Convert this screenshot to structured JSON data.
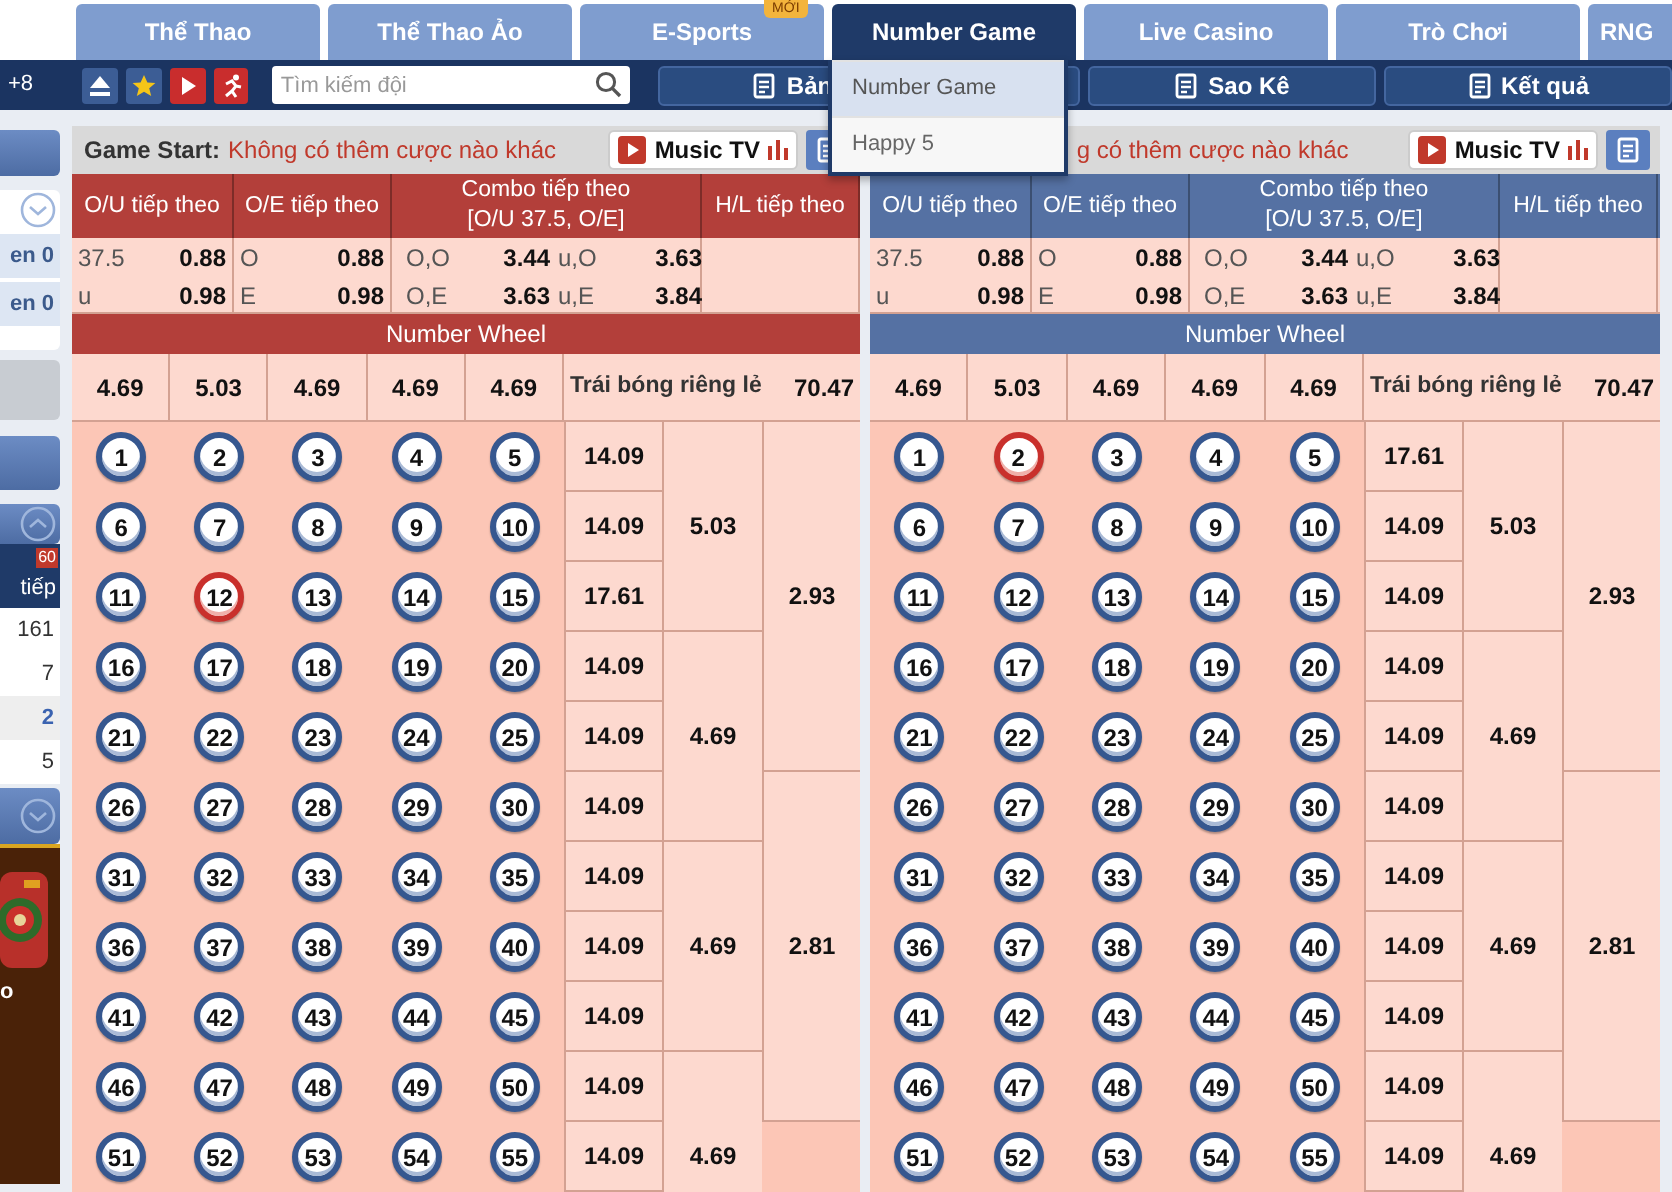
{
  "top_bar": {
    "text": "+8"
  },
  "tabs": [
    {
      "label": "Thể Thao",
      "selected": false
    },
    {
      "label": "Thể Thao Ảo",
      "selected": false
    },
    {
      "label": "E-Sports",
      "selected": false,
      "badge": "MỚI"
    },
    {
      "label": "Number Game",
      "selected": true
    },
    {
      "label": "Live Casino",
      "selected": false
    },
    {
      "label": "Trò Chơi",
      "selected": false
    },
    {
      "label": "RNG",
      "selected": false
    }
  ],
  "search": {
    "placeholder": "Tìm kiếm đội"
  },
  "toolbar_buttons": [
    "Bản",
    "Sao Kê",
    "Kết quả"
  ],
  "dropdown": [
    {
      "label": "Number Game",
      "selected": true
    },
    {
      "label": "Happy 5",
      "selected": false
    }
  ],
  "sidebar": {
    "rows": [
      "en 0",
      "en 0"
    ],
    "header": "tiếp",
    "badge": "60",
    "counts": [
      {
        "text": "161",
        "highlighted": false
      },
      {
        "text": "7",
        "highlighted": false
      },
      {
        "text": "2",
        "highlighted": true
      },
      {
        "text": "5",
        "highlighted": false
      }
    ],
    "game_label": "o"
  },
  "panels": [
    {
      "color": "#b33f3a",
      "header": {
        "label": "Game Start:",
        "status": "Không có thêm cược nào khác"
      },
      "music_button": "Music TV",
      "columns": [
        [
          "O/U tiếp theo"
        ],
        [
          "O/E tiếp theo"
        ],
        [
          "Combo tiếp theo",
          "[O/U 37.5, O/E]"
        ],
        [
          "H/L tiếp theo"
        ]
      ],
      "ou": [
        [
          "37.5",
          "0.88"
        ],
        [
          "u",
          "0.98"
        ]
      ],
      "oe": [
        [
          "O",
          "0.88"
        ],
        [
          "E",
          "0.98"
        ]
      ],
      "combo": [
        [
          "O,O",
          "3.44",
          "u,O",
          "3.63"
        ],
        [
          "O,E",
          "3.63",
          "u,E",
          "3.84"
        ]
      ],
      "wheel_title": "Number Wheel",
      "wheel_odds": [
        "4.69",
        "5.03",
        "4.69",
        "4.69",
        "4.69"
      ],
      "single_ball": {
        "label": "Trái bóng riêng lẻ",
        "odds": "70.47"
      },
      "balls": [
        {
          "number": "1",
          "selected": false
        },
        {
          "number": "2",
          "selected": false
        },
        {
          "number": "3",
          "selected": false
        },
        {
          "number": "4",
          "selected": false
        },
        {
          "number": "5",
          "selected": false
        },
        {
          "number": "6",
          "selected": false
        },
        {
          "number": "7",
          "selected": false
        },
        {
          "number": "8",
          "selected": false
        },
        {
          "number": "9",
          "selected": false
        },
        {
          "number": "10",
          "selected": false
        },
        {
          "number": "11",
          "selected": false
        },
        {
          "number": "12",
          "selected": true
        },
        {
          "number": "13",
          "selected": false
        },
        {
          "number": "14",
          "selected": false
        },
        {
          "number": "15",
          "selected": false
        },
        {
          "number": "16",
          "selected": false
        },
        {
          "number": "17",
          "selected": false
        },
        {
          "number": "18",
          "selected": false
        },
        {
          "number": "19",
          "selected": false
        },
        {
          "number": "20",
          "selected": false
        },
        {
          "number": "21",
          "selected": false
        },
        {
          "number": "22",
          "selected": false
        },
        {
          "number": "23",
          "selected": false
        },
        {
          "number": "24",
          "selected": false
        },
        {
          "number": "25",
          "selected": false
        },
        {
          "number": "26",
          "selected": false
        },
        {
          "number": "27",
          "selected": false
        },
        {
          "number": "28",
          "selected": false
        },
        {
          "number": "29",
          "selected": false
        },
        {
          "number": "30",
          "selected": false
        },
        {
          "number": "31",
          "selected": false
        },
        {
          "number": "32",
          "selected": false
        },
        {
          "number": "33",
          "selected": false
        },
        {
          "number": "34",
          "selected": false
        },
        {
          "number": "35",
          "selected": false
        },
        {
          "number": "36",
          "selected": false
        },
        {
          "number": "37",
          "selected": false
        },
        {
          "number": "38",
          "selected": false
        },
        {
          "number": "39",
          "selected": false
        },
        {
          "number": "40",
          "selected": false
        },
        {
          "number": "41",
          "selected": false
        },
        {
          "number": "42",
          "selected": false
        },
        {
          "number": "43",
          "selected": false
        },
        {
          "number": "44",
          "selected": false
        },
        {
          "number": "45",
          "selected": false
        },
        {
          "number": "46",
          "selected": false
        },
        {
          "number": "47",
          "selected": false
        },
        {
          "number": "48",
          "selected": false
        },
        {
          "number": "49",
          "selected": false
        },
        {
          "number": "50",
          "selected": false
        },
        {
          "number": "51",
          "selected": false
        },
        {
          "number": "52",
          "selected": false
        },
        {
          "number": "53",
          "selected": false
        },
        {
          "number": "54",
          "selected": false
        },
        {
          "number": "55",
          "selected": false
        }
      ],
      "row_odds": [
        "14.09",
        "14.09",
        "17.61",
        "14.09",
        "14.09",
        "14.09",
        "14.09",
        "14.09",
        "14.09",
        "14.09",
        "14.09"
      ],
      "group3_odds": [
        "5.03",
        "4.69",
        "4.69",
        "4.69"
      ],
      "group5_odds": [
        "2.93",
        "2.81"
      ]
    },
    {
      "color": "#5571a3",
      "header": {
        "status": "g có thêm cược nào khác"
      },
      "music_button": "Music TV",
      "columns": [
        [
          "O/U tiếp theo"
        ],
        [
          "O/E tiếp theo"
        ],
        [
          "Combo tiếp theo",
          "[O/U 37.5, O/E]"
        ],
        [
          "H/L tiếp theo"
        ]
      ],
      "ou": [
        [
          "37.5",
          "0.88"
        ],
        [
          "u",
          "0.98"
        ]
      ],
      "oe": [
        [
          "O",
          "0.88"
        ],
        [
          "E",
          "0.98"
        ]
      ],
      "combo": [
        [
          "O,O",
          "3.44",
          "u,O",
          "3.63"
        ],
        [
          "O,E",
          "3.63",
          "u,E",
          "3.84"
        ]
      ],
      "wheel_title": "Number Wheel",
      "wheel_odds": [
        "4.69",
        "5.03",
        "4.69",
        "4.69",
        "4.69"
      ],
      "single_ball": {
        "label": "Trái bóng riêng lẻ",
        "odds": "70.47"
      },
      "balls": [
        {
          "number": "1",
          "selected": false
        },
        {
          "number": "2",
          "selected": true
        },
        {
          "number": "3",
          "selected": false
        },
        {
          "number": "4",
          "selected": false
        },
        {
          "number": "5",
          "selected": false
        },
        {
          "number": "6",
          "selected": false
        },
        {
          "number": "7",
          "selected": false
        },
        {
          "number": "8",
          "selected": false
        },
        {
          "number": "9",
          "selected": false
        },
        {
          "number": "10",
          "selected": false
        },
        {
          "number": "11",
          "selected": false
        },
        {
          "number": "12",
          "selected": false
        },
        {
          "number": "13",
          "selected": false
        },
        {
          "number": "14",
          "selected": false
        },
        {
          "number": "15",
          "selected": false
        },
        {
          "number": "16",
          "selected": false
        },
        {
          "number": "17",
          "selected": false
        },
        {
          "number": "18",
          "selected": false
        },
        {
          "number": "19",
          "selected": false
        },
        {
          "number": "20",
          "selected": false
        },
        {
          "number": "21",
          "selected": false
        },
        {
          "number": "22",
          "selected": false
        },
        {
          "number": "23",
          "selected": false
        },
        {
          "number": "24",
          "selected": false
        },
        {
          "number": "25",
          "selected": false
        },
        {
          "number": "26",
          "selected": false
        },
        {
          "number": "27",
          "selected": false
        },
        {
          "number": "28",
          "selected": false
        },
        {
          "number": "29",
          "selected": false
        },
        {
          "number": "30",
          "selected": false
        },
        {
          "number": "31",
          "selected": false
        },
        {
          "number": "32",
          "selected": false
        },
        {
          "number": "33",
          "selected": false
        },
        {
          "number": "34",
          "selected": false
        },
        {
          "number": "35",
          "selected": false
        },
        {
          "number": "36",
          "selected": false
        },
        {
          "number": "37",
          "selected": false
        },
        {
          "number": "38",
          "selected": false
        },
        {
          "number": "39",
          "selected": false
        },
        {
          "number": "40",
          "selected": false
        },
        {
          "number": "41",
          "selected": false
        },
        {
          "number": "42",
          "selected": false
        },
        {
          "number": "43",
          "selected": false
        },
        {
          "number": "44",
          "selected": false
        },
        {
          "number": "45",
          "selected": false
        },
        {
          "number": "46",
          "selected": false
        },
        {
          "number": "47",
          "selected": false
        },
        {
          "number": "48",
          "selected": false
        },
        {
          "number": "49",
          "selected": false
        },
        {
          "number": "50",
          "selected": false
        },
        {
          "number": "51",
          "selected": false
        },
        {
          "number": "52",
          "selected": false
        },
        {
          "number": "53",
          "selected": false
        },
        {
          "number": "54",
          "selected": false
        },
        {
          "number": "55",
          "selected": false
        }
      ],
      "row_odds": [
        "17.61",
        "14.09",
        "14.09",
        "14.09",
        "14.09",
        "14.09",
        "14.09",
        "14.09",
        "14.09",
        "14.09",
        "14.09"
      ],
      "group3_odds": [
        "5.03",
        "4.69",
        "4.69",
        "4.69"
      ],
      "group5_odds": [
        "2.93",
        "2.81"
      ]
    }
  ]
}
